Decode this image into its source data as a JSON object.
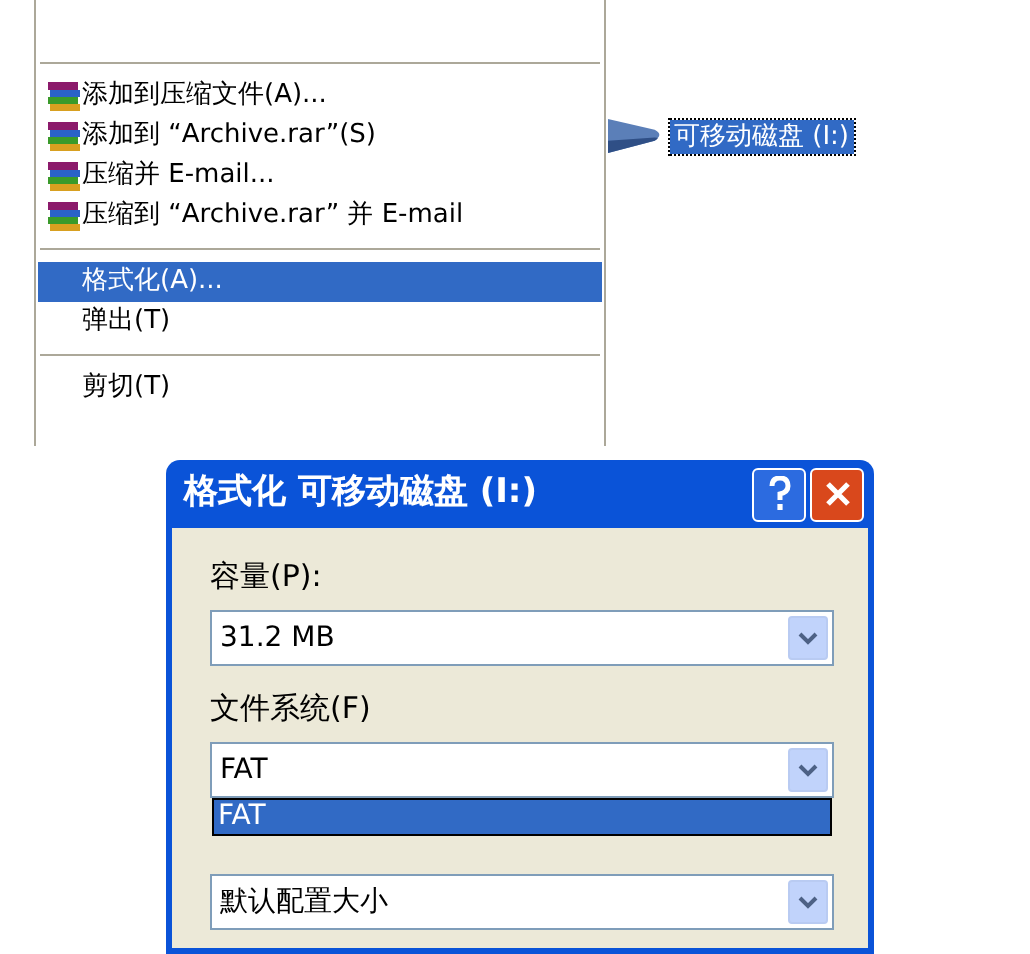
{
  "context_menu": {
    "items": [
      {
        "kind": "separator"
      },
      {
        "kind": "archive",
        "label": "添加到压缩文件(A)...",
        "selected": false
      },
      {
        "kind": "archive",
        "label": "添加到 “Archive.rar”(S)",
        "selected": false
      },
      {
        "kind": "archive",
        "label": "压缩并 E-mail...",
        "selected": false
      },
      {
        "kind": "archive",
        "label": "压缩到 “Archive.rar” 并 E-mail",
        "selected": false
      },
      {
        "kind": "separator"
      },
      {
        "kind": "plain",
        "label": "格式化(A)...",
        "selected": true
      },
      {
        "kind": "plain",
        "label": "弹出(T)",
        "selected": false
      },
      {
        "kind": "separator"
      },
      {
        "kind": "plain",
        "label": "剪切(T)",
        "selected": false
      }
    ]
  },
  "drive": {
    "label": "可移动磁盘 (I:)",
    "selected": true
  },
  "dialog": {
    "title": "格式化 可移动磁盘 (I:)",
    "fields": [
      {
        "label": "容量(P):",
        "value": "31.2 MB"
      },
      {
        "label": "文件系统(F)",
        "value": "FAT",
        "open_list": [
          {
            "label": "FAT",
            "selected": true
          }
        ]
      },
      {
        "value": "默认配置大小"
      }
    ]
  }
}
